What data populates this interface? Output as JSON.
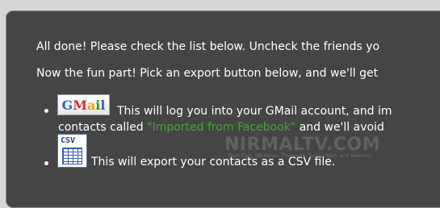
{
  "intro": {
    "line1": "All done! Please check the list below. Uncheck the friends yo",
    "line2": "Now the fun part! Pick an export button below, and we'll get"
  },
  "gmail_option": {
    "button_label_parts": [
      "G",
      "M",
      "a",
      "i",
      "l"
    ],
    "icon": "gmail-logo-icon",
    "text_line1": "This will log you into your GMail account, and im",
    "text_line2_prefix": "contacts called ",
    "group_name": "\"Imported from Facebook\"",
    "text_line2_suffix": " and we'll avoid"
  },
  "csv_option": {
    "button_label": "CSV",
    "icon": "csv-spreadsheet-icon",
    "text": "This will export your contacts as a CSV file."
  },
  "watermark": {
    "title": "NIRMALTV.COM",
    "tagline": "Tech Tips, Windows, Freeware, Social Web and Internet"
  },
  "colors": {
    "panel_bg": "#454545",
    "page_bg": "#d6d6d6",
    "group_name": "#4a9f3c"
  }
}
